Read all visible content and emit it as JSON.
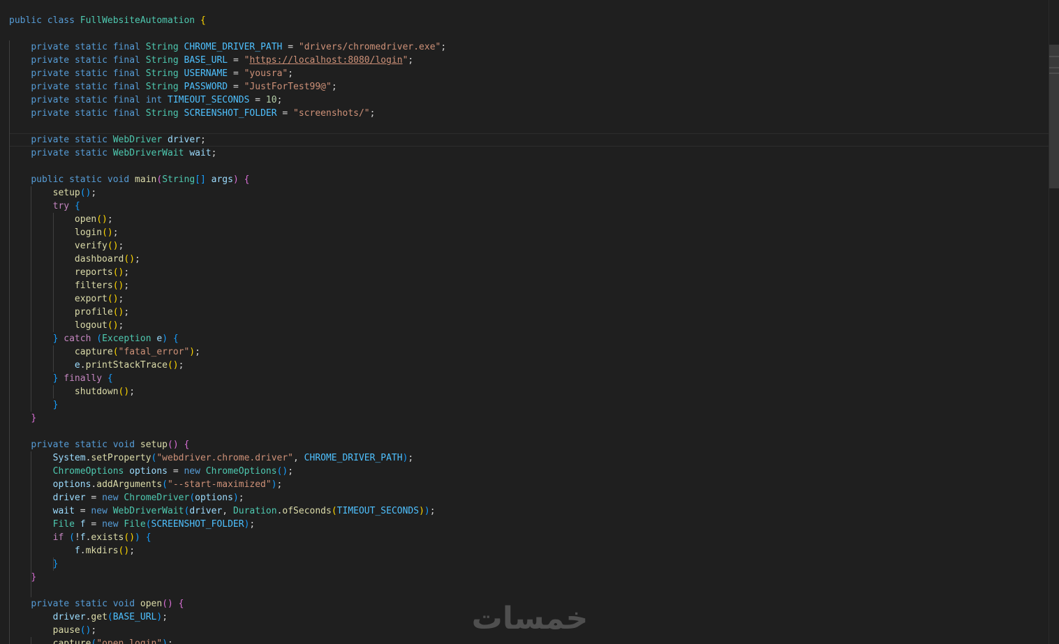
{
  "colors": {
    "keyword": "#569cd6",
    "control": "#c586c0",
    "type": "#4ec9b0",
    "variable": "#9cdcfe",
    "constant": "#4fc1ff",
    "function": "#dcdcaa",
    "string": "#ce9178",
    "number": "#b5cea8",
    "punctuation": "#d4d4d4",
    "bracket1": "#ffd700",
    "bracket2": "#da70d6",
    "bracket3": "#179fff",
    "background": "#1f1f1f"
  },
  "watermark": {
    "text": "خمسات"
  },
  "code_lines": [
    [
      [
        "public",
        "kw"
      ],
      [
        " ",
        "p"
      ],
      [
        "class",
        "kw"
      ],
      [
        " ",
        "p"
      ],
      [
        "FullWebsiteAutomation",
        "ty"
      ],
      [
        " ",
        "p"
      ],
      [
        "{",
        "b1"
      ]
    ],
    [],
    [
      [
        "    ",
        "p"
      ],
      [
        "private",
        "kw"
      ],
      [
        " ",
        "p"
      ],
      [
        "static",
        "kw"
      ],
      [
        " ",
        "p"
      ],
      [
        "final",
        "kw"
      ],
      [
        " ",
        "p"
      ],
      [
        "String",
        "ty"
      ],
      [
        " ",
        "p"
      ],
      [
        "CHROME_DRIVER_PATH",
        "const"
      ],
      [
        " = ",
        "p"
      ],
      [
        "\"drivers/chromedriver.exe\"",
        "str"
      ],
      [
        ";",
        "p"
      ]
    ],
    [
      [
        "    ",
        "p"
      ],
      [
        "private",
        "kw"
      ],
      [
        " ",
        "p"
      ],
      [
        "static",
        "kw"
      ],
      [
        " ",
        "p"
      ],
      [
        "final",
        "kw"
      ],
      [
        " ",
        "p"
      ],
      [
        "String",
        "ty"
      ],
      [
        " ",
        "p"
      ],
      [
        "BASE_URL",
        "const"
      ],
      [
        " = ",
        "p"
      ],
      [
        "\"",
        "str"
      ],
      [
        "https://localhost:8080/login",
        "strlink"
      ],
      [
        "\"",
        "str"
      ],
      [
        ";",
        "p"
      ]
    ],
    [
      [
        "    ",
        "p"
      ],
      [
        "private",
        "kw"
      ],
      [
        " ",
        "p"
      ],
      [
        "static",
        "kw"
      ],
      [
        " ",
        "p"
      ],
      [
        "final",
        "kw"
      ],
      [
        " ",
        "p"
      ],
      [
        "String",
        "ty"
      ],
      [
        " ",
        "p"
      ],
      [
        "USERNAME",
        "const"
      ],
      [
        " = ",
        "p"
      ],
      [
        "\"yousra\"",
        "str"
      ],
      [
        ";",
        "p"
      ]
    ],
    [
      [
        "    ",
        "p"
      ],
      [
        "private",
        "kw"
      ],
      [
        " ",
        "p"
      ],
      [
        "static",
        "kw"
      ],
      [
        " ",
        "p"
      ],
      [
        "final",
        "kw"
      ],
      [
        " ",
        "p"
      ],
      [
        "String",
        "ty"
      ],
      [
        " ",
        "p"
      ],
      [
        "PASSWORD",
        "const"
      ],
      [
        " = ",
        "p"
      ],
      [
        "\"JustForTest99@\"",
        "str"
      ],
      [
        ";",
        "p"
      ]
    ],
    [
      [
        "    ",
        "p"
      ],
      [
        "private",
        "kw"
      ],
      [
        " ",
        "p"
      ],
      [
        "static",
        "kw"
      ],
      [
        " ",
        "p"
      ],
      [
        "final",
        "kw"
      ],
      [
        " ",
        "p"
      ],
      [
        "int",
        "kw"
      ],
      [
        " ",
        "p"
      ],
      [
        "TIMEOUT_SECONDS",
        "const"
      ],
      [
        " = ",
        "p"
      ],
      [
        "10",
        "num"
      ],
      [
        ";",
        "p"
      ]
    ],
    [
      [
        "    ",
        "p"
      ],
      [
        "private",
        "kw"
      ],
      [
        " ",
        "p"
      ],
      [
        "static",
        "kw"
      ],
      [
        " ",
        "p"
      ],
      [
        "final",
        "kw"
      ],
      [
        " ",
        "p"
      ],
      [
        "String",
        "ty"
      ],
      [
        " ",
        "p"
      ],
      [
        "SCREENSHOT_FOLDER",
        "const"
      ],
      [
        " = ",
        "p"
      ],
      [
        "\"screenshots/\"",
        "str"
      ],
      [
        ";",
        "p"
      ]
    ],
    [],
    [
      [
        "    ",
        "p"
      ],
      [
        "private",
        "kw"
      ],
      [
        " ",
        "p"
      ],
      [
        "static",
        "kw"
      ],
      [
        " ",
        "p"
      ],
      [
        "WebDriver",
        "ty"
      ],
      [
        " ",
        "p"
      ],
      [
        "driver",
        "var"
      ],
      [
        ";",
        "p"
      ]
    ],
    [
      [
        "    ",
        "p"
      ],
      [
        "private",
        "kw"
      ],
      [
        " ",
        "p"
      ],
      [
        "static",
        "kw"
      ],
      [
        " ",
        "p"
      ],
      [
        "WebDriverWait",
        "ty"
      ],
      [
        " ",
        "p"
      ],
      [
        "wait",
        "var"
      ],
      [
        ";",
        "p"
      ]
    ],
    [],
    [
      [
        "    ",
        "p"
      ],
      [
        "public",
        "kw"
      ],
      [
        " ",
        "p"
      ],
      [
        "static",
        "kw"
      ],
      [
        " ",
        "p"
      ],
      [
        "void",
        "kw"
      ],
      [
        " ",
        "p"
      ],
      [
        "main",
        "fn"
      ],
      [
        "(",
        "b2"
      ],
      [
        "String",
        "ty"
      ],
      [
        "[]",
        "b3"
      ],
      [
        " ",
        "p"
      ],
      [
        "args",
        "var"
      ],
      [
        ")",
        "b2"
      ],
      [
        " ",
        "p"
      ],
      [
        "{",
        "b2"
      ]
    ],
    [
      [
        "        ",
        "p"
      ],
      [
        "setup",
        "fn"
      ],
      [
        "()",
        "b3"
      ],
      [
        ";",
        "p"
      ]
    ],
    [
      [
        "        ",
        "p"
      ],
      [
        "try",
        "ctl"
      ],
      [
        " ",
        "p"
      ],
      [
        "{",
        "b3"
      ]
    ],
    [
      [
        "            ",
        "p"
      ],
      [
        "open",
        "fn"
      ],
      [
        "()",
        "b1"
      ],
      [
        ";",
        "p"
      ]
    ],
    [
      [
        "            ",
        "p"
      ],
      [
        "login",
        "fn"
      ],
      [
        "()",
        "b1"
      ],
      [
        ";",
        "p"
      ]
    ],
    [
      [
        "            ",
        "p"
      ],
      [
        "verify",
        "fn"
      ],
      [
        "()",
        "b1"
      ],
      [
        ";",
        "p"
      ]
    ],
    [
      [
        "            ",
        "p"
      ],
      [
        "dashboard",
        "fn"
      ],
      [
        "()",
        "b1"
      ],
      [
        ";",
        "p"
      ]
    ],
    [
      [
        "            ",
        "p"
      ],
      [
        "reports",
        "fn"
      ],
      [
        "()",
        "b1"
      ],
      [
        ";",
        "p"
      ]
    ],
    [
      [
        "            ",
        "p"
      ],
      [
        "filters",
        "fn"
      ],
      [
        "()",
        "b1"
      ],
      [
        ";",
        "p"
      ]
    ],
    [
      [
        "            ",
        "p"
      ],
      [
        "export",
        "fn"
      ],
      [
        "()",
        "b1"
      ],
      [
        ";",
        "p"
      ]
    ],
    [
      [
        "            ",
        "p"
      ],
      [
        "profile",
        "fn"
      ],
      [
        "()",
        "b1"
      ],
      [
        ";",
        "p"
      ]
    ],
    [
      [
        "            ",
        "p"
      ],
      [
        "logout",
        "fn"
      ],
      [
        "()",
        "b1"
      ],
      [
        ";",
        "p"
      ]
    ],
    [
      [
        "        ",
        "p"
      ],
      [
        "}",
        "b3"
      ],
      [
        " ",
        "p"
      ],
      [
        "catch",
        "ctl"
      ],
      [
        " ",
        "p"
      ],
      [
        "(",
        "b3"
      ],
      [
        "Exception",
        "ty"
      ],
      [
        " ",
        "p"
      ],
      [
        "e",
        "var"
      ],
      [
        ")",
        "b3"
      ],
      [
        " ",
        "p"
      ],
      [
        "{",
        "b3"
      ]
    ],
    [
      [
        "            ",
        "p"
      ],
      [
        "capture",
        "fn"
      ],
      [
        "(",
        "b1"
      ],
      [
        "\"fatal_error\"",
        "str"
      ],
      [
        ")",
        "b1"
      ],
      [
        ";",
        "p"
      ]
    ],
    [
      [
        "            ",
        "p"
      ],
      [
        "e",
        "var"
      ],
      [
        ".",
        "p"
      ],
      [
        "printStackTrace",
        "fn"
      ],
      [
        "()",
        "b1"
      ],
      [
        ";",
        "p"
      ]
    ],
    [
      [
        "        ",
        "p"
      ],
      [
        "}",
        "b3"
      ],
      [
        " ",
        "p"
      ],
      [
        "finally",
        "ctl"
      ],
      [
        " ",
        "p"
      ],
      [
        "{",
        "b3"
      ]
    ],
    [
      [
        "            ",
        "p"
      ],
      [
        "shutdown",
        "fn"
      ],
      [
        "()",
        "b1"
      ],
      [
        ";",
        "p"
      ]
    ],
    [
      [
        "        ",
        "p"
      ],
      [
        "}",
        "b3"
      ]
    ],
    [
      [
        "    ",
        "p"
      ],
      [
        "}",
        "b2"
      ]
    ],
    [],
    [
      [
        "    ",
        "p"
      ],
      [
        "private",
        "kw"
      ],
      [
        " ",
        "p"
      ],
      [
        "static",
        "kw"
      ],
      [
        " ",
        "p"
      ],
      [
        "void",
        "kw"
      ],
      [
        " ",
        "p"
      ],
      [
        "setup",
        "fn"
      ],
      [
        "()",
        "b2"
      ],
      [
        " ",
        "p"
      ],
      [
        "{",
        "b2"
      ]
    ],
    [
      [
        "        ",
        "p"
      ],
      [
        "System",
        "var"
      ],
      [
        ".",
        "p"
      ],
      [
        "setProperty",
        "fn"
      ],
      [
        "(",
        "b3"
      ],
      [
        "\"webdriver.chrome.driver\"",
        "str"
      ],
      [
        ", ",
        "p"
      ],
      [
        "CHROME_DRIVER_PATH",
        "const"
      ],
      [
        ")",
        "b3"
      ],
      [
        ";",
        "p"
      ]
    ],
    [
      [
        "        ",
        "p"
      ],
      [
        "ChromeOptions",
        "ty"
      ],
      [
        " ",
        "p"
      ],
      [
        "options",
        "var"
      ],
      [
        " = ",
        "p"
      ],
      [
        "new",
        "kw"
      ],
      [
        " ",
        "p"
      ],
      [
        "ChromeOptions",
        "ty"
      ],
      [
        "()",
        "b3"
      ],
      [
        ";",
        "p"
      ]
    ],
    [
      [
        "        ",
        "p"
      ],
      [
        "options",
        "var"
      ],
      [
        ".",
        "p"
      ],
      [
        "addArguments",
        "fn"
      ],
      [
        "(",
        "b3"
      ],
      [
        "\"--start-maximized\"",
        "str"
      ],
      [
        ")",
        "b3"
      ],
      [
        ";",
        "p"
      ]
    ],
    [
      [
        "        ",
        "p"
      ],
      [
        "driver",
        "var"
      ],
      [
        " = ",
        "p"
      ],
      [
        "new",
        "kw"
      ],
      [
        " ",
        "p"
      ],
      [
        "ChromeDriver",
        "ty"
      ],
      [
        "(",
        "b3"
      ],
      [
        "options",
        "var"
      ],
      [
        ")",
        "b3"
      ],
      [
        ";",
        "p"
      ]
    ],
    [
      [
        "        ",
        "p"
      ],
      [
        "wait",
        "var"
      ],
      [
        " = ",
        "p"
      ],
      [
        "new",
        "kw"
      ],
      [
        " ",
        "p"
      ],
      [
        "WebDriverWait",
        "ty"
      ],
      [
        "(",
        "b3"
      ],
      [
        "driver",
        "var"
      ],
      [
        ", ",
        "p"
      ],
      [
        "Duration",
        "ty"
      ],
      [
        ".",
        "p"
      ],
      [
        "ofSeconds",
        "fn"
      ],
      [
        "(",
        "b1"
      ],
      [
        "TIMEOUT_SECONDS",
        "const"
      ],
      [
        ")",
        "b1"
      ],
      [
        ")",
        "b3"
      ],
      [
        ";",
        "p"
      ]
    ],
    [
      [
        "        ",
        "p"
      ],
      [
        "File",
        "ty"
      ],
      [
        " ",
        "p"
      ],
      [
        "f",
        "var"
      ],
      [
        " = ",
        "p"
      ],
      [
        "new",
        "kw"
      ],
      [
        " ",
        "p"
      ],
      [
        "File",
        "ty"
      ],
      [
        "(",
        "b3"
      ],
      [
        "SCREENSHOT_FOLDER",
        "const"
      ],
      [
        ")",
        "b3"
      ],
      [
        ";",
        "p"
      ]
    ],
    [
      [
        "        ",
        "p"
      ],
      [
        "if",
        "ctl"
      ],
      [
        " ",
        "p"
      ],
      [
        "(",
        "b3"
      ],
      [
        "!",
        "p"
      ],
      [
        "f",
        "var"
      ],
      [
        ".",
        "p"
      ],
      [
        "exists",
        "fn"
      ],
      [
        "()",
        "b1"
      ],
      [
        ")",
        "b3"
      ],
      [
        " ",
        "p"
      ],
      [
        "{",
        "b3"
      ]
    ],
    [
      [
        "            ",
        "p"
      ],
      [
        "f",
        "var"
      ],
      [
        ".",
        "p"
      ],
      [
        "mkdirs",
        "fn"
      ],
      [
        "()",
        "b1"
      ],
      [
        ";",
        "p"
      ]
    ],
    [
      [
        "        ",
        "p"
      ],
      [
        "}",
        "b3"
      ]
    ],
    [
      [
        "    ",
        "p"
      ],
      [
        "}",
        "b2"
      ]
    ],
    [],
    [
      [
        "    ",
        "p"
      ],
      [
        "private",
        "kw"
      ],
      [
        " ",
        "p"
      ],
      [
        "static",
        "kw"
      ],
      [
        " ",
        "p"
      ],
      [
        "void",
        "kw"
      ],
      [
        " ",
        "p"
      ],
      [
        "open",
        "fn"
      ],
      [
        "()",
        "b2"
      ],
      [
        " ",
        "p"
      ],
      [
        "{",
        "b2"
      ]
    ],
    [
      [
        "        ",
        "p"
      ],
      [
        "driver",
        "var"
      ],
      [
        ".",
        "p"
      ],
      [
        "get",
        "fn"
      ],
      [
        "(",
        "b3"
      ],
      [
        "BASE_URL",
        "const"
      ],
      [
        ")",
        "b3"
      ],
      [
        ";",
        "p"
      ]
    ],
    [
      [
        "        ",
        "p"
      ],
      [
        "pause",
        "fn"
      ],
      [
        "()",
        "b3"
      ],
      [
        ";",
        "p"
      ]
    ],
    [
      [
        "        ",
        "p"
      ],
      [
        "capture",
        "fn"
      ],
      [
        "(",
        "b3"
      ],
      [
        "\"open_login\"",
        "str"
      ],
      [
        ")",
        "b3"
      ],
      [
        ";",
        "p"
      ]
    ]
  ]
}
